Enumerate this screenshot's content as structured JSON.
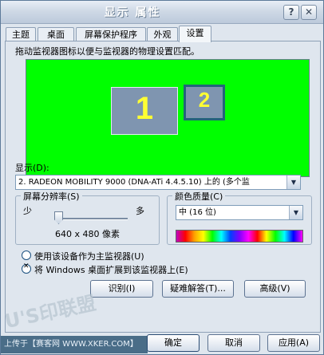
{
  "window": {
    "title": "显示  属性"
  },
  "titlebar_buttons": {
    "help": "?",
    "close": "✕"
  },
  "tabs": [
    {
      "label": "主题"
    },
    {
      "label": "桌面"
    },
    {
      "label": "屏幕保护程序"
    },
    {
      "label": "外观"
    },
    {
      "label": "设置"
    }
  ],
  "settings": {
    "description": "拖动监视器图标以便与监视器的物理设置匹配。",
    "monitors": [
      {
        "label": "1"
      },
      {
        "label": "2"
      }
    ],
    "display_label": "显示(D):",
    "display_value": "2. RADEON MOBILITY 9000 (DNA-ATi 4.4.5.10) 上的 (多个监",
    "resolution": {
      "group_title": "屏幕分辨率(S)",
      "min_label": "少",
      "max_label": "多",
      "value_text": "640 x 480 像素",
      "slider_level": 0.0
    },
    "color_quality": {
      "group_title": "颜色质量(C)",
      "selected": "中 (16 位)"
    },
    "options": [
      {
        "label": "使用该设备作为主监视器(U)",
        "checked": false
      },
      {
        "label": "将 Windows 桌面扩展到该监视器上(E)",
        "checked": true
      }
    ],
    "buttons": {
      "identify": "识别(I)",
      "troubleshoot": "疑难解答(T)...",
      "advanced": "高级(V)"
    }
  },
  "footer": {
    "ok": "确定",
    "cancel": "取消",
    "apply": "应用(A)",
    "watermark": "上传于【赛客网 WWW.XKER.COM】",
    "stamp": "U'S印联盟"
  }
}
